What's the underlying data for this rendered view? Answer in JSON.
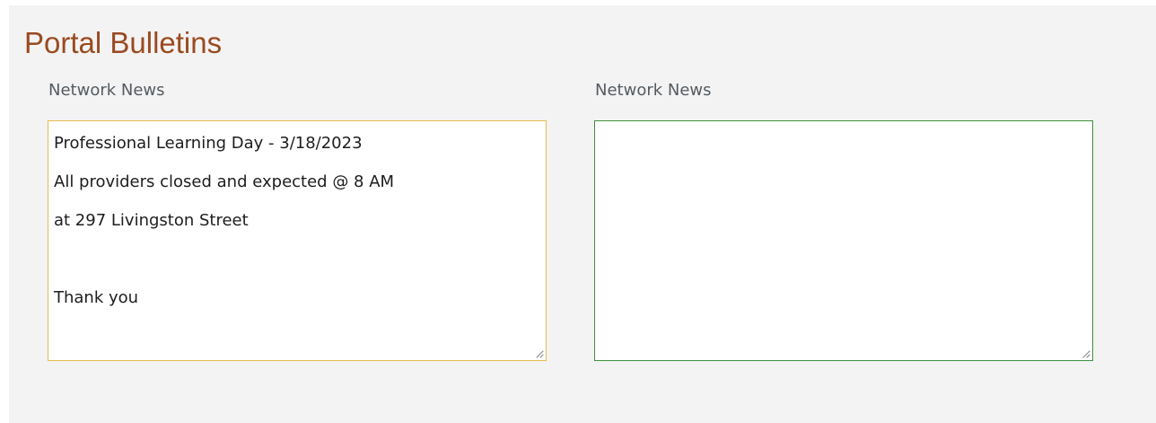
{
  "page": {
    "title": "Portal Bulletins"
  },
  "bulletins": [
    {
      "label": "Network News",
      "lines": [
        "Professional Learning Day - 3/18/2023",
        "All providers closed and expected @ 8 AM",
        "at 297 Livingston Street",
        "",
        "Thank you"
      ]
    },
    {
      "label": "Network News",
      "lines": []
    }
  ],
  "icons": {
    "resize_handle": "resize-grip-icon"
  },
  "colors": {
    "title": "#9a4a21",
    "panel_background": "#f3f3f3",
    "left_box_border": "#e4bd4a",
    "right_box_border": "#3f8f3f",
    "label_text": "#555b61"
  }
}
